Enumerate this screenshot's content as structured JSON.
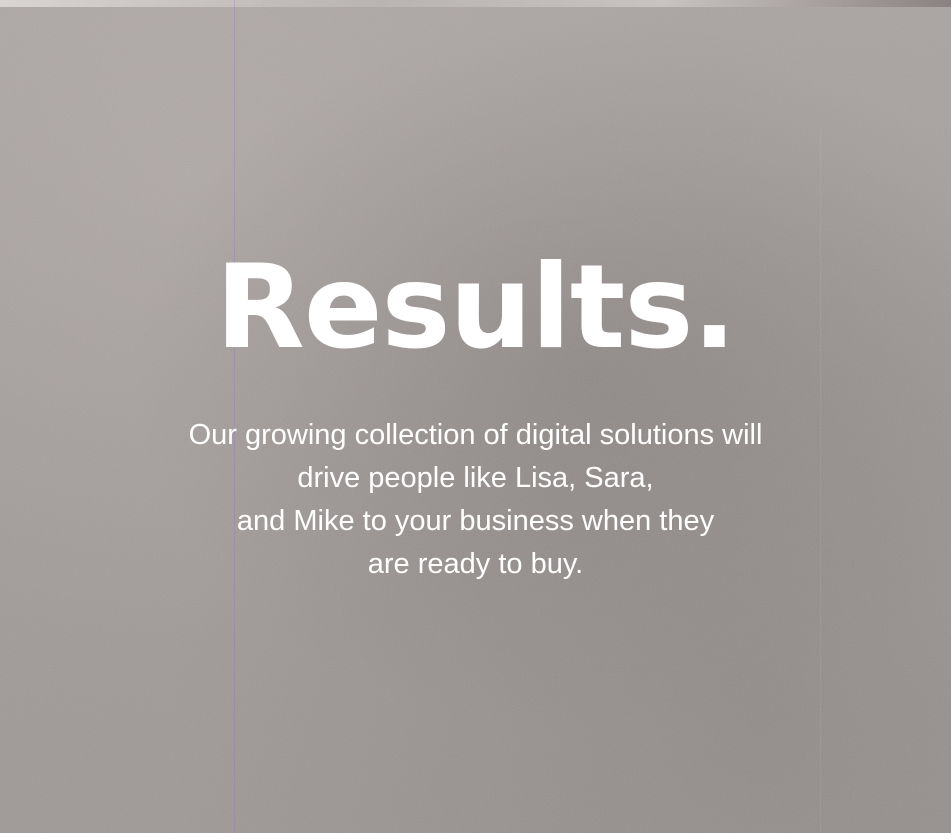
{
  "headline": "Results.",
  "body_lines": [
    "Our growing collection of digital solutions will",
    "drive people like Lisa, Sara,",
    "and Mike to your business when they",
    "are ready to buy."
  ],
  "colors": {
    "background": "#a49e9c",
    "text": "#ffffff",
    "fold_line": "#9678be"
  }
}
